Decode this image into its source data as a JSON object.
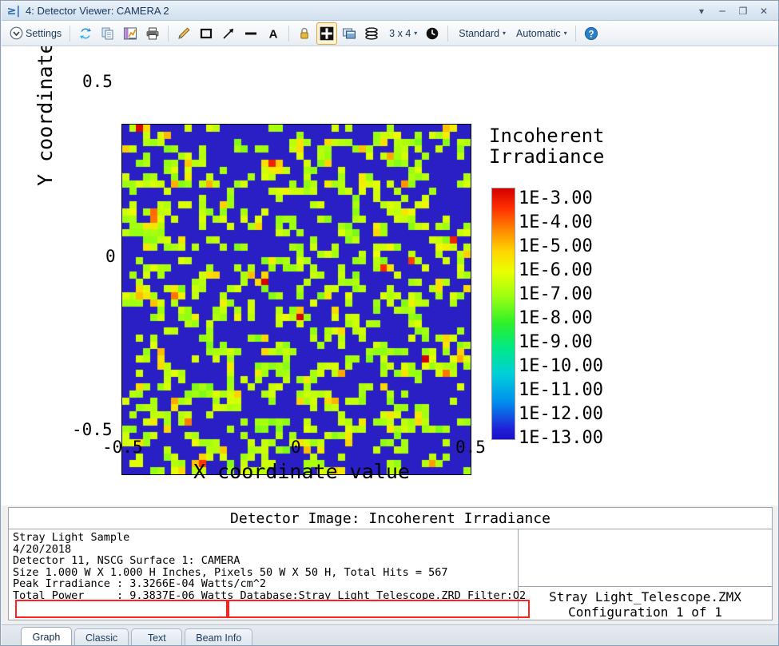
{
  "window": {
    "icon": "detector-window-icon",
    "title": "4: Detector Viewer: CAMERA 2",
    "controls": {
      "menu": "▾",
      "minimize": "─",
      "maximize": "❐",
      "close": "✕"
    }
  },
  "toolbar": {
    "settings_label": "Settings",
    "layout_label": "3 x 4",
    "style_label": "Standard",
    "scale_label": "Automatic",
    "caret": "▾",
    "items": [
      "settings-button",
      "refresh-button",
      "copy-button",
      "save-button",
      "print-button",
      "pencil-tool",
      "rectangle-tool",
      "arrow-tool",
      "line-tool",
      "text-tool",
      "lock-button",
      "grid-button",
      "overlay-button",
      "layers-button",
      "layout-dropdown",
      "clock-button",
      "style-dropdown",
      "scale-dropdown",
      "help-button"
    ]
  },
  "chart_data": {
    "type": "heatmap",
    "title": "Detector Image: Incoherent Irradiance",
    "xlabel": "X coordinate value",
    "ylabel": "Y coordinate value",
    "xticks": [
      "-0.5",
      "0",
      "0.5"
    ],
    "yticks": [
      "0.5",
      "0",
      "-0.5"
    ],
    "xlim": [
      -0.5,
      0.5
    ],
    "ylim": [
      -0.5,
      0.5
    ],
    "grid": false,
    "rows": 50,
    "cols": 50,
    "total_hits": 567,
    "background_color": "#2a1fc4",
    "legend_position": "right",
    "colorbar": {
      "title_line1": "Incoherent",
      "title_line2": "Irradiance",
      "labels": [
        "1E-3.00",
        "1E-4.00",
        "1E-5.00",
        "1E-6.00",
        "1E-7.00",
        "1E-8.00",
        "1E-9.00",
        "1E-10.00",
        "1E-11.00",
        "1E-12.00",
        "1E-13.00"
      ],
      "top_color": "#d40000",
      "bottom_color": "#1a10c8",
      "scale": "log"
    }
  },
  "info": {
    "header": "Detector Image: Incoherent Irradiance",
    "lines": [
      "Stray Light Sample",
      "4/20/2018",
      "Detector 11, NSCG Surface 1: CAMERA",
      "Size 1.000 W X 1.000 H Inches, Pixels 50 W X 50 H, Total Hits = 567",
      "Peak Irradiance : 3.3266E-04 Watts/cm^2",
      "Total Power     : 9.3837E-06 Watts Database:Stray Light_Telescope.ZRD Filter:O2"
    ],
    "right_line1": "Stray Light_Telescope.ZMX",
    "right_line2": "Configuration 1 of 1",
    "annotation_color": "#ff2020"
  },
  "tabs": [
    {
      "label": "Graph",
      "active": true
    },
    {
      "label": "Classic",
      "active": false
    },
    {
      "label": "Text",
      "active": false
    },
    {
      "label": "Beam Info",
      "active": false
    }
  ]
}
